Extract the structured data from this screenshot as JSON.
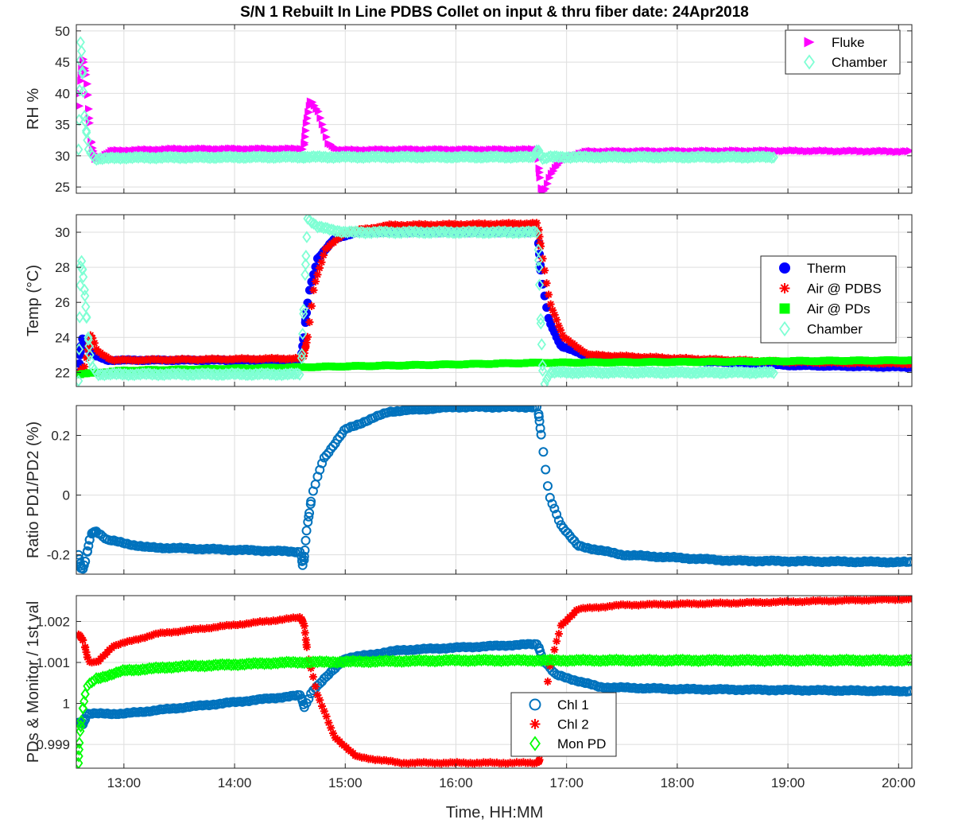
{
  "figure": {
    "title": "S/N 1 Rebuilt In Line PDBS Collet on input & thru fiber date: 24Apr2018",
    "xlabel": "Time, HH:MM"
  },
  "chart_data": [
    {
      "id": "rh",
      "type": "scatter",
      "ylabel": "RH %",
      "xlim": [
        12.57,
        20.12
      ],
      "ylim": [
        24,
        51
      ],
      "yticks": [
        25,
        30,
        35,
        40,
        45,
        50
      ],
      "yticklabels": [
        "25",
        "30",
        "35",
        "40",
        "45",
        "50"
      ],
      "grid": true,
      "legend": "top-right",
      "series": [
        {
          "name": "Fluke",
          "marker": "triangle-right",
          "color": "#ff00ff",
          "noise": 0.12,
          "step": 0.018,
          "points": [
            [
              12.6,
              38
            ],
            [
              12.63,
              46
            ],
            [
              12.67,
              42
            ],
            [
              12.7,
              33
            ],
            [
              12.74,
              29.5
            ],
            [
              12.8,
              29.8
            ],
            [
              12.9,
              30.8
            ],
            [
              13.5,
              31.1
            ],
            [
              14.63,
              31.1
            ],
            [
              14.65,
              35
            ],
            [
              14.69,
              39
            ],
            [
              14.76,
              37
            ],
            [
              14.85,
              32
            ],
            [
              14.95,
              30.9
            ],
            [
              15.5,
              31.0
            ],
            [
              16.74,
              31.0
            ],
            [
              16.77,
              25
            ],
            [
              16.8,
              24.2
            ],
            [
              16.86,
              27
            ],
            [
              16.97,
              29.6
            ],
            [
              17.2,
              30.7
            ],
            [
              19.0,
              30.8
            ],
            [
              20.12,
              30.7
            ]
          ]
        },
        {
          "name": "Chamber",
          "marker": "diamond",
          "color": "#7fffd4",
          "noise": 0.15,
          "step": 0.018,
          "xend": 18.88,
          "points": [
            [
              12.59,
              31
            ],
            [
              12.61,
              50
            ],
            [
              12.64,
              37
            ],
            [
              12.68,
              31
            ],
            [
              12.74,
              29.5
            ],
            [
              13.0,
              29.7
            ],
            [
              14.6,
              29.8
            ],
            [
              14.65,
              29.8
            ],
            [
              16.7,
              29.8
            ],
            [
              16.74,
              31.2
            ],
            [
              16.78,
              29.5
            ],
            [
              16.85,
              29.8
            ],
            [
              18.88,
              29.8
            ]
          ]
        }
      ]
    },
    {
      "id": "temp",
      "type": "scatter",
      "ylabel": "Temp (°C)",
      "xlim": [
        12.57,
        20.12
      ],
      "ylim": [
        21.2,
        31.0
      ],
      "yticks": [
        22,
        24,
        26,
        28,
        30
      ],
      "yticklabels": [
        "22",
        "24",
        "26",
        "28",
        "30"
      ],
      "grid": true,
      "legend": "right",
      "series": [
        {
          "name": "Therm",
          "marker": "circle-filled",
          "color": "#0000ff",
          "noise": 0.04,
          "step": 0.018,
          "points": [
            [
              12.59,
              22
            ],
            [
              12.62,
              24
            ],
            [
              12.66,
              23.6
            ],
            [
              12.72,
              23.0
            ],
            [
              12.85,
              22.7
            ],
            [
              14.6,
              22.7
            ],
            [
              14.63,
              24.3
            ],
            [
              14.67,
              26.5
            ],
            [
              14.75,
              28.5
            ],
            [
              14.9,
              29.6
            ],
            [
              15.1,
              30.0
            ],
            [
              16.74,
              30.0
            ],
            [
              16.77,
              27.5
            ],
            [
              16.84,
              25.0
            ],
            [
              16.95,
              23.5
            ],
            [
              17.2,
              22.9
            ],
            [
              18.0,
              22.7
            ],
            [
              19.0,
              22.4
            ],
            [
              20.12,
              22.3
            ]
          ]
        },
        {
          "name": "Air @ PDBS",
          "marker": "asterisk",
          "color": "#ff0000",
          "noise": 0.05,
          "step": 0.018,
          "points": [
            [
              12.59,
              22
            ],
            [
              12.65,
              22.4
            ],
            [
              12.7,
              24.2
            ],
            [
              12.76,
              23.2
            ],
            [
              12.9,
              22.7
            ],
            [
              14.62,
              22.8
            ],
            [
              14.66,
              24.0
            ],
            [
              14.72,
              27.0
            ],
            [
              14.82,
              29.0
            ],
            [
              15.0,
              30.0
            ],
            [
              15.4,
              30.4
            ],
            [
              16.74,
              30.5
            ],
            [
              16.77,
              29.0
            ],
            [
              16.85,
              26.0
            ],
            [
              16.97,
              24.0
            ],
            [
              17.2,
              23.0
            ],
            [
              18.0,
              22.8
            ],
            [
              19.0,
              22.6
            ],
            [
              20.12,
              22.5
            ]
          ]
        },
        {
          "name": "Air @ PDs",
          "marker": "square-filled",
          "color": "#00ff00",
          "noise": 0.04,
          "step": 0.018,
          "points": [
            [
              12.59,
              21.9
            ],
            [
              13.0,
              22.1
            ],
            [
              14.6,
              22.3
            ],
            [
              16.74,
              22.55
            ],
            [
              18.0,
              22.6
            ],
            [
              20.12,
              22.7
            ]
          ]
        },
        {
          "name": "Chamber",
          "marker": "diamond",
          "color": "#7fffd4",
          "noise": 0.06,
          "step": 0.018,
          "xend": 18.88,
          "points": [
            [
              12.59,
              21.5
            ],
            [
              12.61,
              28.8
            ],
            [
              12.64,
              27.0
            ],
            [
              12.67,
              24.5
            ],
            [
              12.7,
              22.5
            ],
            [
              12.76,
              21.9
            ],
            [
              14.6,
              21.9
            ],
            [
              14.63,
              26.5
            ],
            [
              14.66,
              30.8
            ],
            [
              14.75,
              30.3
            ],
            [
              15.0,
              30.0
            ],
            [
              16.74,
              30.0
            ],
            [
              16.76,
              26.0
            ],
            [
              16.79,
              21.2
            ],
            [
              16.85,
              22.0
            ],
            [
              17.0,
              22.0
            ],
            [
              18.88,
              22.0
            ]
          ]
        }
      ]
    },
    {
      "id": "ratio",
      "type": "scatter",
      "ylabel": "Ratio PD1/PD2 (%)",
      "xlim": [
        12.57,
        20.12
      ],
      "ylim": [
        -0.265,
        0.3
      ],
      "yticks": [
        -0.2,
        0,
        0.2
      ],
      "yticklabels": [
        "-0.2",
        "0",
        "0.2"
      ],
      "grid": true,
      "series": [
        {
          "name": "",
          "marker": "circle",
          "color": "#0072bd",
          "noise": 0.003,
          "step": 0.02,
          "points": [
            [
              12.59,
              -0.2
            ],
            [
              12.62,
              -0.26
            ],
            [
              12.66,
              -0.21
            ],
            [
              12.7,
              -0.13
            ],
            [
              12.75,
              -0.12
            ],
            [
              12.85,
              -0.15
            ],
            [
              13.2,
              -0.175
            ],
            [
              14.6,
              -0.19
            ],
            [
              14.62,
              -0.25
            ],
            [
              14.65,
              -0.12
            ],
            [
              14.7,
              0.0
            ],
            [
              14.8,
              0.12
            ],
            [
              15.0,
              0.22
            ],
            [
              15.4,
              0.28
            ],
            [
              16.0,
              0.295
            ],
            [
              16.74,
              0.295
            ],
            [
              16.77,
              0.2
            ],
            [
              16.84,
              0.0
            ],
            [
              16.95,
              -0.1
            ],
            [
              17.1,
              -0.17
            ],
            [
              17.5,
              -0.2
            ],
            [
              18.5,
              -0.22
            ],
            [
              20.12,
              -0.225
            ]
          ]
        }
      ]
    },
    {
      "id": "pds",
      "type": "scatter",
      "ylabel": "PDs & Monitor / 1st val",
      "xlim": [
        12.57,
        20.12
      ],
      "ylim": [
        0.99842,
        1.00263
      ],
      "yticks": [
        0.999,
        1.0,
        1.001,
        1.002
      ],
      "yticklabels": [
        "0.999",
        "1",
        "1.001",
        "1.002"
      ],
      "grid": true,
      "legend": "bottom-center",
      "series": [
        {
          "name": "Chl 1",
          "marker": "circle",
          "color": "#0072bd",
          "noise": 2e-05,
          "step": 0.02,
          "points": [
            [
              12.59,
              0.99955
            ],
            [
              12.63,
              0.9995
            ],
            [
              12.67,
              0.99975
            ],
            [
              12.75,
              0.99975
            ],
            [
              13.0,
              0.99975
            ],
            [
              14.6,
              1.0002
            ],
            [
              14.63,
              0.9999
            ],
            [
              14.7,
              1.0003
            ],
            [
              15.0,
              1.0011
            ],
            [
              15.5,
              1.0013
            ],
            [
              16.74,
              1.00145
            ],
            [
              16.78,
              1.0011
            ],
            [
              16.9,
              1.0007
            ],
            [
              17.3,
              1.0004
            ],
            [
              18.0,
              1.00035
            ],
            [
              20.12,
              1.0003
            ]
          ]
        },
        {
          "name": "Chl 2",
          "marker": "asterisk",
          "color": "#ff0000",
          "noise": 2e-05,
          "step": 0.02,
          "points": [
            [
              12.59,
              1.0017
            ],
            [
              12.64,
              1.0015
            ],
            [
              12.68,
              1.001
            ],
            [
              12.76,
              1.001
            ],
            [
              12.9,
              1.0014
            ],
            [
              13.3,
              1.0017
            ],
            [
              14.6,
              1.0021
            ],
            [
              14.63,
              1.0019
            ],
            [
              14.66,
              1.0012
            ],
            [
              14.75,
              1.0002
            ],
            [
              14.9,
              0.9992
            ],
            [
              15.1,
              0.9987
            ],
            [
              15.5,
              0.99855
            ],
            [
              16.74,
              0.99855
            ],
            [
              16.76,
              0.99865
            ],
            [
              16.84,
              1.0008
            ],
            [
              16.95,
              1.0019
            ],
            [
              17.1,
              1.0023
            ],
            [
              17.5,
              1.0024
            ],
            [
              18.5,
              1.00245
            ],
            [
              20.12,
              1.00255
            ]
          ]
        },
        {
          "name": "Mon PD",
          "marker": "diamond",
          "color": "#00ff00",
          "noise": 2e-05,
          "step": 0.02,
          "points": [
            [
              12.59,
              0.99855
            ],
            [
              12.6,
              0.9992
            ],
            [
              12.62,
              0.9997
            ],
            [
              12.66,
              1.0004
            ],
            [
              12.75,
              1.0006
            ],
            [
              13.0,
              1.0008
            ],
            [
              13.5,
              1.0009
            ],
            [
              14.5,
              1.001
            ],
            [
              16.0,
              1.00105
            ],
            [
              20.12,
              1.00105
            ]
          ]
        }
      ]
    }
  ],
  "x_axis": {
    "ticks": [
      13,
      14,
      15,
      16,
      17,
      18,
      19,
      20
    ],
    "ticklabels": [
      "13:00",
      "14:00",
      "15:00",
      "16:00",
      "17:00",
      "18:00",
      "19:00",
      "20:00"
    ]
  }
}
